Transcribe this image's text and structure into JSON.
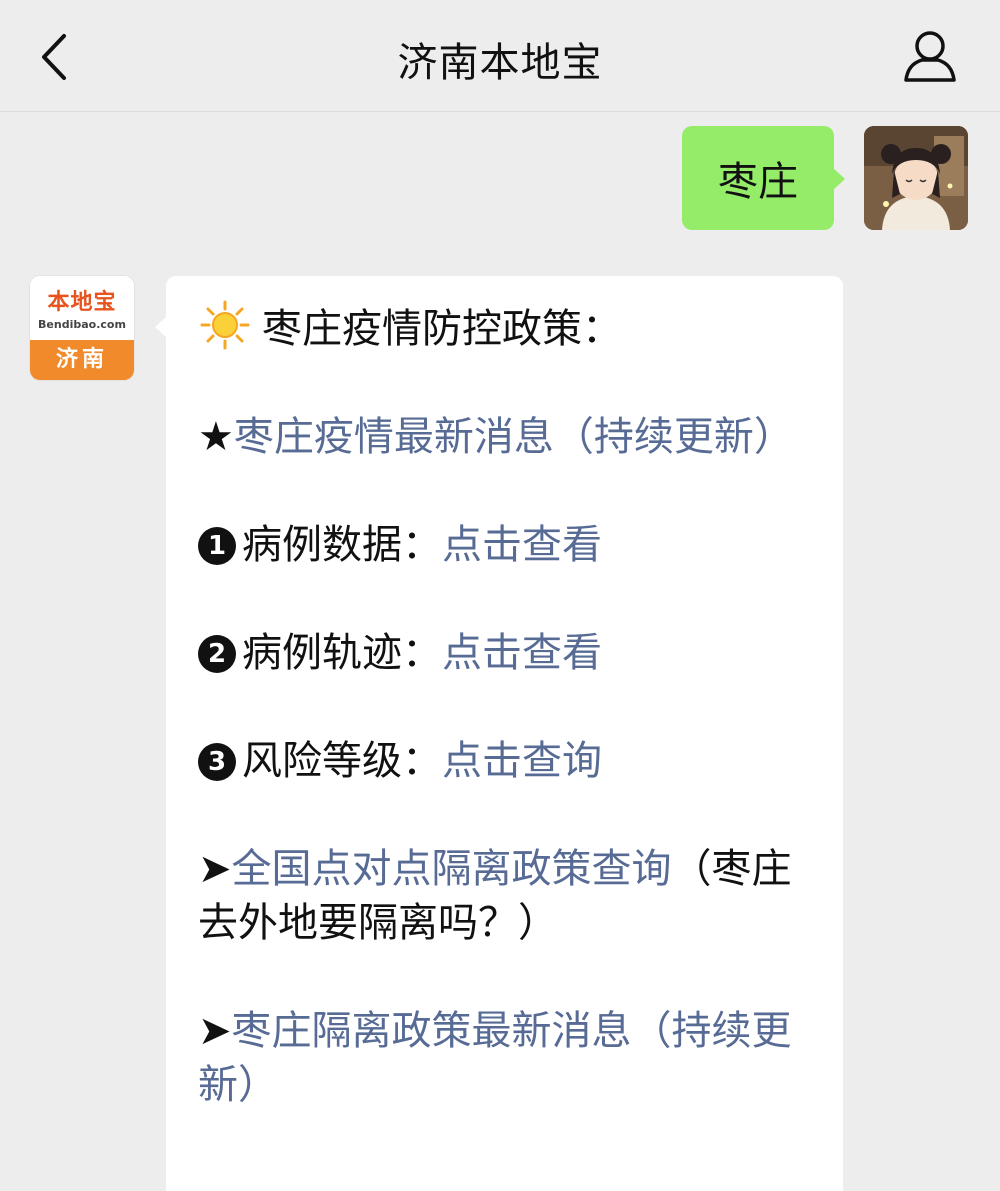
{
  "header": {
    "title": "济南本地宝",
    "back_icon": "chevron-left-icon",
    "profile_icon": "person-icon"
  },
  "user_message": {
    "text": "枣庄",
    "bubble_color": "#95ec69"
  },
  "bot": {
    "avatar": {
      "brand": "本地宝",
      "url": "Bendibao.com",
      "city": "济南",
      "accent": "#f08a2a"
    },
    "heading": "枣庄疫情防控政策：",
    "items": {
      "latest_news": {
        "prefix": "★",
        "link": "枣庄疫情最新消息（持续更新）"
      },
      "case_data": {
        "number": "1",
        "label": "病例数据：",
        "link": "点击查看"
      },
      "case_track": {
        "number": "2",
        "label": "病例轨迹：",
        "link": "点击查看"
      },
      "risk_level": {
        "number": "3",
        "label": "风险等级：",
        "link": "点击查询"
      },
      "quarantine_query": {
        "prefix": "➤",
        "link": "全国点对点隔离政策查询",
        "suffix": "（枣庄去外地要隔离吗？）"
      },
      "quarantine_news": {
        "prefix": "➤",
        "link": "枣庄隔离政策最新消息（持续更新）"
      }
    },
    "link_color": "#576b95"
  }
}
